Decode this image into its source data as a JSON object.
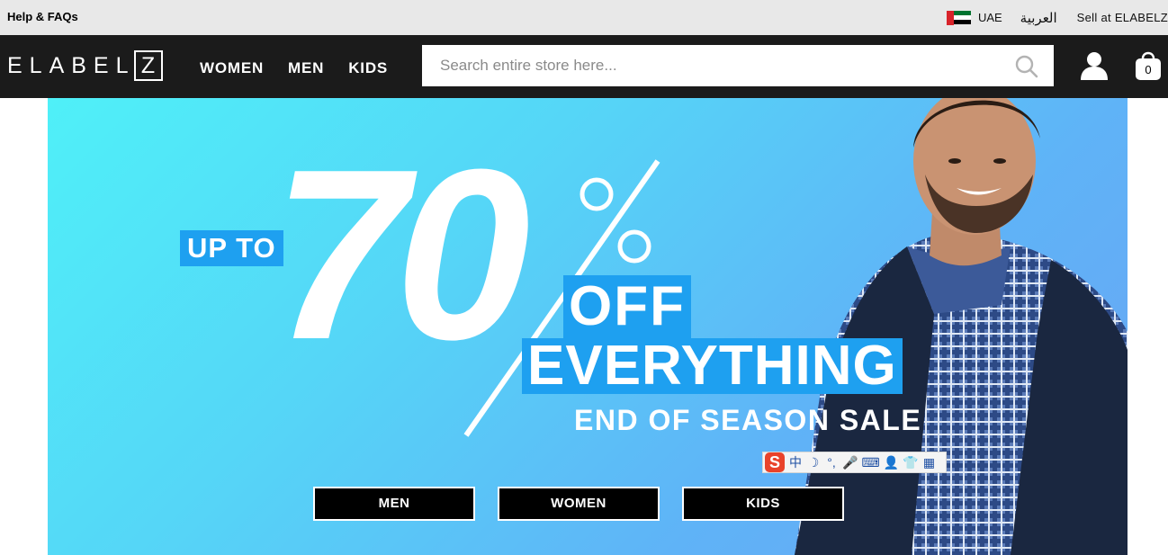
{
  "topbar": {
    "help_label": "Help & FAQs",
    "country_label": "UAE",
    "language_label": "العربية",
    "sell_label": "Sell at ELABELZ"
  },
  "header": {
    "logo_text": "ELABEL",
    "logo_box_letter": "Z",
    "nav": [
      {
        "label": "WOMEN"
      },
      {
        "label": "MEN"
      },
      {
        "label": "KIDS"
      }
    ],
    "search": {
      "placeholder": "Search entire store here...",
      "value": ""
    },
    "cart_count": "0"
  },
  "hero": {
    "up_to": "UP TO",
    "discount_number": "70",
    "off": "OFF",
    "everything": "EVERYTHING",
    "subtitle": "END OF SEASON SALE",
    "buttons": [
      {
        "label": "MEN"
      },
      {
        "label": "WOMEN"
      },
      {
        "label": "KIDS"
      }
    ]
  },
  "ime_toolbar": {
    "logo": "S",
    "mode": "中",
    "moon": "☽",
    "punct": "°,",
    "mic": "🎤",
    "keyboard": "⌨",
    "person": "👤",
    "shirt": "👕",
    "grid": "▦"
  },
  "colors": {
    "nav_bg": "#1b1b1b",
    "topbar_bg": "#e8e8e8",
    "accent_blue": "#1ea0f0",
    "hero_gradient_start": "#4ff0f8",
    "hero_gradient_end": "#6aa4f3"
  },
  "icons": [
    "search-icon",
    "user-icon",
    "cart-icon",
    "uae-flag-icon"
  ]
}
